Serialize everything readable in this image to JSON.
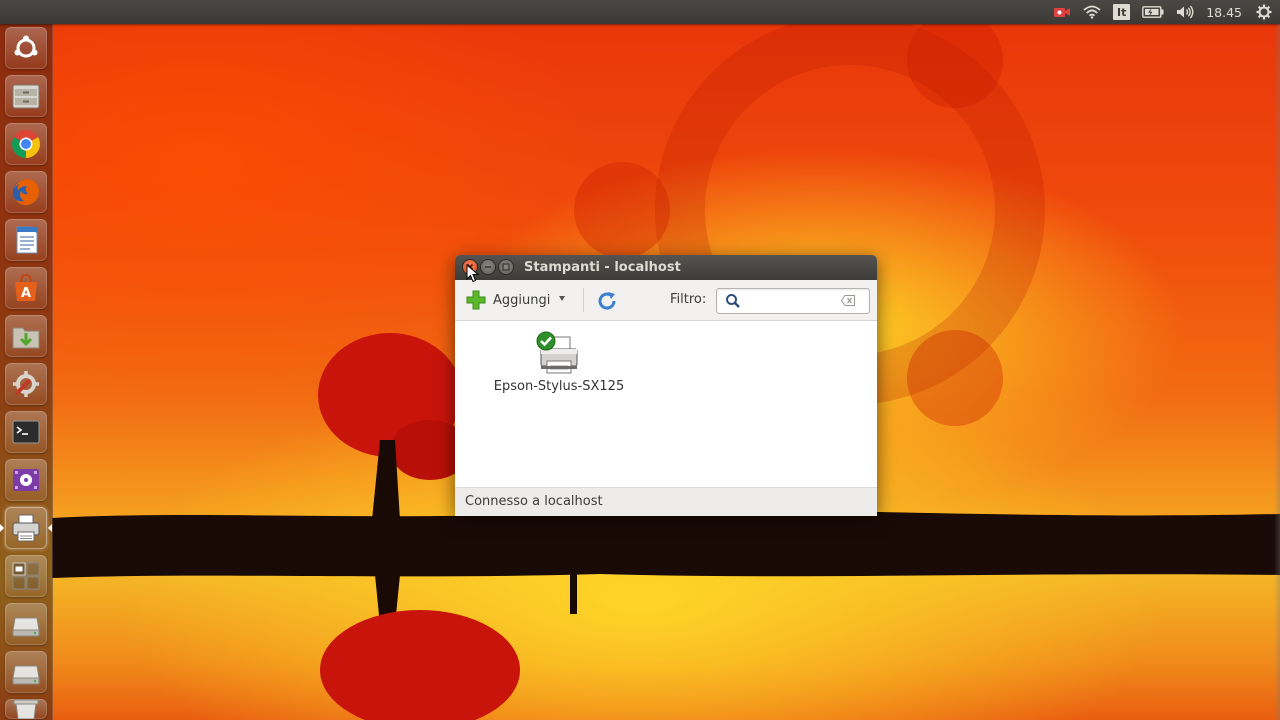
{
  "top_panel": {
    "tray": {
      "recording_icon": "video-camera-icon",
      "wifi_icon": "wifi-icon",
      "keyboard_layout": "It",
      "battery_icon": "battery-icon",
      "volume_icon": "volume-icon",
      "clock": "18.45",
      "settings_icon": "gear-icon"
    }
  },
  "launcher": {
    "items": [
      {
        "name": "dash-home",
        "icon": "ubuntu-logo-icon"
      },
      {
        "name": "files",
        "icon": "file-cabinet-icon"
      },
      {
        "name": "chrome",
        "icon": "chrome-icon"
      },
      {
        "name": "firefox",
        "icon": "firefox-icon"
      },
      {
        "name": "libreoffice-writer",
        "icon": "document-icon"
      },
      {
        "name": "software-center",
        "icon": "shopping-bag-icon"
      },
      {
        "name": "downloads",
        "icon": "download-folder-icon"
      },
      {
        "name": "system-settings",
        "icon": "wrench-gear-icon"
      },
      {
        "name": "terminal",
        "icon": "terminal-icon"
      },
      {
        "name": "media-player",
        "icon": "media-icon"
      },
      {
        "name": "printers",
        "icon": "printer-icon",
        "active": true
      },
      {
        "name": "workspace-switcher",
        "icon": "workspace-icon"
      },
      {
        "name": "drive-1",
        "icon": "drive-icon"
      },
      {
        "name": "drive-2",
        "icon": "drive-icon"
      },
      {
        "name": "trash",
        "icon": "trash-icon"
      }
    ]
  },
  "window": {
    "title": "Stampanti - localhost",
    "toolbar": {
      "add_label": "Aggiungi",
      "filter_label": "Filtro:",
      "filter_value": "",
      "filter_placeholder": ""
    },
    "printers": [
      {
        "name": "Epson-Stylus-SX125",
        "default": true
      }
    ],
    "status": "Connesso a localhost"
  },
  "colors": {
    "panel_bg": "#3b3a36",
    "close_button": "#e2561f",
    "add_green": "#5ab82a",
    "refresh_blue": "#3a7fd0"
  }
}
